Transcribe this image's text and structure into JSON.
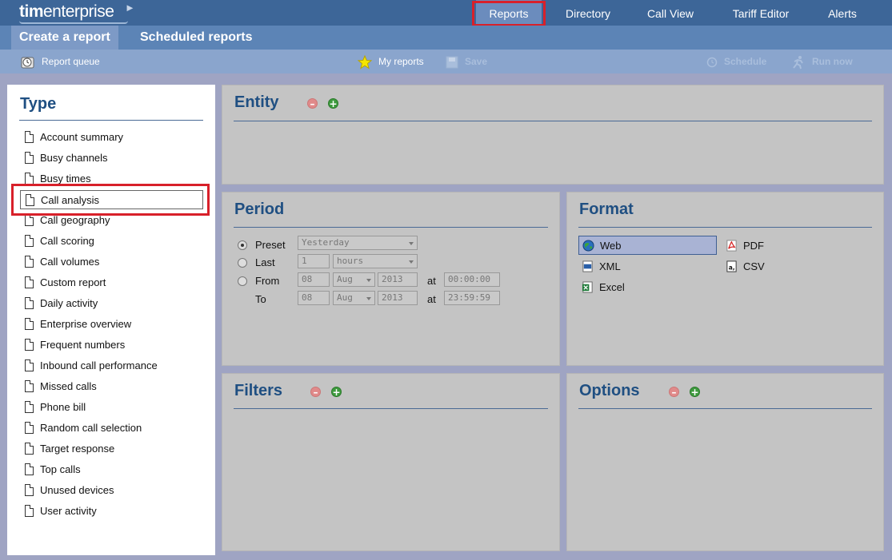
{
  "header": {
    "logo_bold": "tim",
    "logo_rest": "enterprise",
    "nav": [
      {
        "label": "Reports"
      },
      {
        "label": "Directory"
      },
      {
        "label": "Call View"
      },
      {
        "label": "Tariff Editor"
      },
      {
        "label": "Alerts"
      }
    ]
  },
  "subtabs": [
    {
      "label": "Create a report"
    },
    {
      "label": "Scheduled reports"
    }
  ],
  "toolbar": {
    "report_queue": "Report queue",
    "my_reports": "My reports",
    "save": "Save",
    "schedule": "Schedule",
    "run_now": "Run now"
  },
  "type_panel": {
    "title": "Type",
    "items": [
      "Account summary",
      "Busy channels",
      "Busy times",
      "Call analysis",
      "Call geography",
      "Call scoring",
      "Call volumes",
      "Custom report",
      "Daily activity",
      "Enterprise overview",
      "Frequent numbers",
      "Inbound call performance",
      "Missed calls",
      "Phone bill",
      "Random call selection",
      "Target response",
      "Top calls",
      "Unused devices",
      "User activity"
    ],
    "selected": "Call analysis"
  },
  "entity": {
    "title": "Entity"
  },
  "period": {
    "title": "Period",
    "preset_label": "Preset",
    "preset_value": "Yesterday",
    "last_label": "Last",
    "last_value": "1",
    "last_unit": "hours",
    "from_label": "From",
    "to_label": "To",
    "at_label": "at",
    "from": {
      "day": "08",
      "month": "Aug",
      "year": "2013",
      "time": "00:00:00"
    },
    "to": {
      "day": "08",
      "month": "Aug",
      "year": "2013",
      "time": "23:59:59"
    },
    "selected_option": "Preset"
  },
  "format": {
    "title": "Format",
    "options": [
      "Web",
      "PDF",
      "XML",
      "CSV",
      "Excel"
    ],
    "selected": "Web"
  },
  "filters": {
    "title": "Filters"
  },
  "options": {
    "title": "Options"
  },
  "colors": {
    "topbar": "#3d6698",
    "accent_title": "#1f4f82",
    "highlight_red": "#d8202a"
  }
}
